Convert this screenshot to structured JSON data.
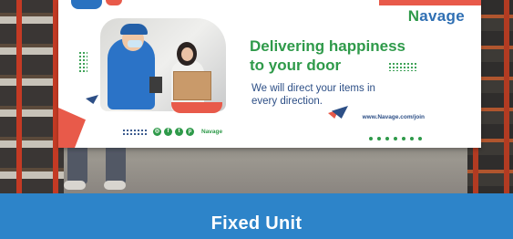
{
  "banner": {
    "logo_letter": "N",
    "logo_rest": "avage",
    "headline_line1": "Delivering happiness",
    "headline_line2": "to your door",
    "subline_line1": "We will direct your items in",
    "subline_line2": "every direction.",
    "url": "www.Navage.com/join",
    "brand_small": "Navage",
    "social_icons": [
      "instagram-icon",
      "facebook-icon",
      "twitter-icon",
      "pinterest-icon"
    ]
  },
  "caption": "Fixed Unit",
  "colors": {
    "green": "#2f9a4a",
    "navy": "#2d4f86",
    "red": "#e85a4a",
    "caption_blue": "#2d84c9"
  }
}
